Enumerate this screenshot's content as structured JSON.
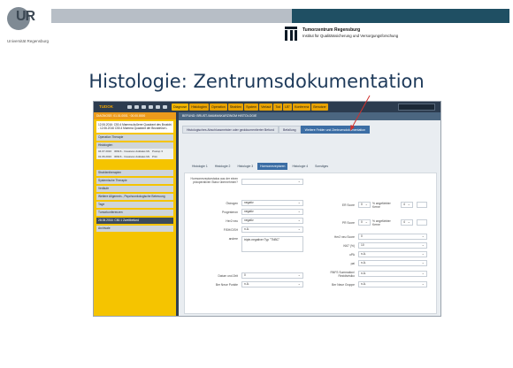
{
  "header": {
    "logo_text": "UR",
    "university": "Universität Regensburg",
    "tz_title": "Tumorzentrum Regensburg",
    "tz_subtitle": "Institut für Qualitätssicherung und Versorgungsforschung"
  },
  "slide_title": "Histologie: Zentrumsdokumentation",
  "app": {
    "brand": "TUDOK",
    "menu": [
      "Diagnose",
      "Histologien",
      "Operation",
      "Strahlen",
      "System",
      "Verlauf",
      "Tod",
      "LB°",
      "Konferenz",
      "Benutzer"
    ],
    "active_menu": "Diagnose"
  },
  "left_panel": {
    "header": "DIAGNOSE: 01.01.0001 · 00.00.0000",
    "diag_lines": [
      "12.06.2016: C50.4 Mamma äußerer Quadrant des Brustdrüse L",
      "- 12.06.2016 C50.4 Mamma Quadrant der Brustdrüse L"
    ],
    "sections": [
      "Operation Therapie",
      "Histologien"
    ],
    "rows": [
      {
        "date": "04.07.2016",
        "text": "30916 - Invasives duktales Mammakarzinom",
        "tag": "Postop 3"
      },
      {
        "date": "01.06.2016",
        "text": "30916 - Invasives duktales Mammakarzinom",
        "tag": "Prim"
      }
    ],
    "sections2": [
      "Strahlentherapien",
      "Systemische Therapie",
      "Verläufe",
      "Weitere Allgemein-, Psychoonkologische Betreuung",
      "Tage",
      "Tumorkonferenzen"
    ],
    "dark_section": "28.06.2016: C50.1 Zweitbefund",
    "archive": "Archivale"
  },
  "main": {
    "header": "BEFUND: BRUST-/MAMMAKARZINOM HISTOLOGIE",
    "tabs1": [
      "Histologisches Abschlussmeister oder gedokumentierter Befund",
      "Befallung",
      "Weitere Felder und Zentrumsdokumentation"
    ],
    "active_tab1": "Weitere Felder und Zentrumsdokumentation",
    "tabs2": [
      "Histologie 1",
      "Histologie 2",
      "Histologie 3",
      "Hormonrezeptoren",
      "Histologie 4",
      "Sonstiges"
    ],
    "active_tab2": "Hormonrezeptoren",
    "form": {
      "hr_label": "Hormonrezeptorstatus aus der einen präoperativen Stanz übernehmen?",
      "oestrogen_label": "Östrogen",
      "oestrogen_value": "negativ",
      "progesteron_label": "Progesteron",
      "progesteron_value": "negativ",
      "her2_label": "Her2 neu",
      "her2_value": "negativ",
      "fish_label": "FISH/CISH",
      "fish_value": "n.A.",
      "andere_label": "andere",
      "andere_value": "triple-negativer Typ \"TNBC\"",
      "datum_label": "Datum und Zeit",
      "datum_value": "0",
      "neupunkte_label": "Ber Neue Punkte",
      "neupunkte_value": "n.A.",
      "er_label": "ER Score",
      "er_value": "0",
      "er_pct_label": "% angefärbter Kerne",
      "er_pct_value": "4",
      "pr_label": "PR Score",
      "pr_value": "0",
      "pr_pct_label": "% angefärbter Kerne",
      "pr_pct_value": "4",
      "her2score_label": "Her2 neu Score",
      "her2score_value": "0",
      "ki67_label": "Ki67 (%)",
      "ki67_value": "10",
      "upa_label": "uPA",
      "upa_value": "n.A.",
      "pai_label": "pai",
      "pai_value": "n.A.",
      "rnfs_label": "RNFS Summation/ Rezidivrisiko",
      "rnfs_value": "n.A.",
      "gruppe_label": "Ber Neue Gruppe",
      "gruppe_value": "n.A."
    }
  }
}
